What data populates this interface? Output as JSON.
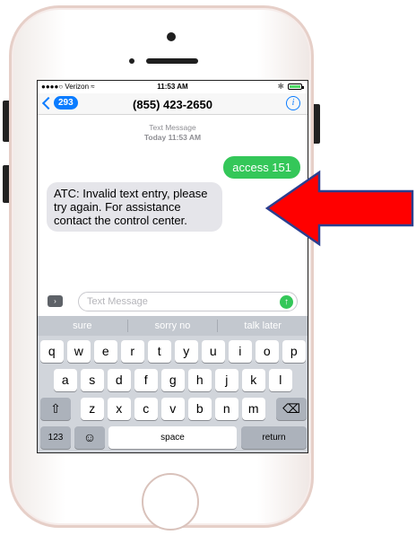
{
  "status_bar": {
    "carrier": "●●●●○ Verizon ≈",
    "time": "11:53 AM",
    "bluetooth": "✱",
    "battery_level": 0.85
  },
  "nav": {
    "back_count": "293",
    "contact": "(855) 423-2650",
    "info_icon": "i"
  },
  "conversation": {
    "label": "Text Message",
    "timestamp": "Today 11:53 AM",
    "messages": [
      {
        "direction": "outgoing",
        "text": "access 151"
      },
      {
        "direction": "incoming",
        "text": "ATC: Invalid text entry, please try again. For assistance contact the control center."
      }
    ]
  },
  "compose": {
    "apps_icon": "›",
    "placeholder": "Text Message",
    "send_icon": "↑"
  },
  "keyboard": {
    "suggestions": [
      "sure",
      "sorry no",
      "talk later"
    ],
    "row1": [
      "q",
      "w",
      "e",
      "r",
      "t",
      "y",
      "u",
      "i",
      "o",
      "p"
    ],
    "row2": [
      "a",
      "s",
      "d",
      "f",
      "g",
      "h",
      "j",
      "k",
      "l"
    ],
    "row3": [
      "z",
      "x",
      "c",
      "v",
      "b",
      "n",
      "m"
    ],
    "shift_icon": "⇧",
    "delete_icon": "⌫",
    "numbers_label": "123",
    "emoji_icon": "☺",
    "space_label": "space",
    "return_label": "return"
  },
  "annotation": {
    "arrow_color": "#ff0000",
    "arrow_outline": "#2b3f8f"
  }
}
